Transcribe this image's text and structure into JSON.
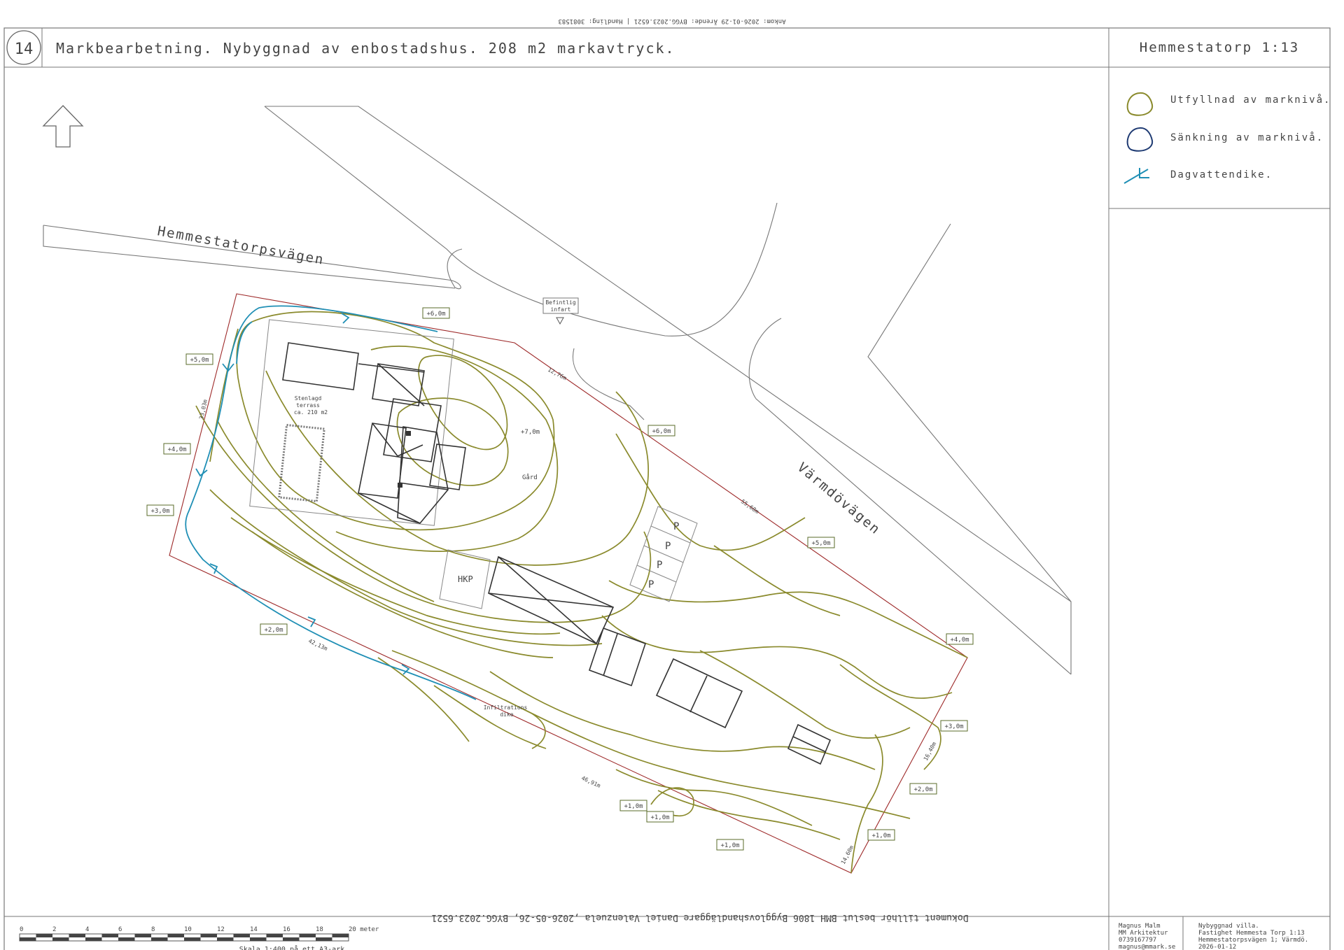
{
  "top_stamp": "Ankom: 2026-01-29 Ärende: BYGG.2023.6521 | Handling: 3081583",
  "sheet_number": "14",
  "header_title": "Markbearbetning. Nybyggnad av enbostadshus. 208 m2 markavtryck.",
  "header_right": "Hemmestatorp 1:13",
  "legend": {
    "fill": "Utfyllnad av marknivå.",
    "lower": "Sänkning av marknivå.",
    "ditch": "Dagvattendike."
  },
  "colors": {
    "fill_contour": "#8a8a2c",
    "lower_contour": "#1f3b73",
    "ditch": "#1f8fb5",
    "boundary": "#9e2a2a",
    "line": "#555555"
  },
  "roads": {
    "road1": "Hemmestatorpsvägen",
    "road2": "Värmdövägen"
  },
  "site_labels": {
    "entrance": [
      "Befintlig",
      "infart"
    ],
    "terrace": [
      "Stenlagd",
      "terrass",
      "ca. 210 m2"
    ],
    "yard": "Gård",
    "peak": "+7,0m",
    "hkp": "HKP",
    "infiltration": [
      "Infiltrations",
      "dike"
    ],
    "parking": [
      "P",
      "P",
      "P",
      "P"
    ]
  },
  "boundary_lengths": [
    "12,76m",
    "55,68m",
    "16,40m",
    "14,60m",
    "46,91m",
    "42,13m",
    "33,03m"
  ],
  "levels": [
    "+6,0m",
    "+5,0m",
    "+4,0m",
    "+3,0m",
    "+2,0m",
    "+6,0m",
    "+5,0m",
    "+4,0m",
    "+3,0m",
    "+2,0m",
    "+1,0m",
    "+1,0m",
    "+1,0m",
    "+1,0m"
  ],
  "scale": {
    "ticks": [
      "0",
      "2",
      "4",
      "6",
      "8",
      "10",
      "12",
      "14",
      "16",
      "18",
      "20 meter"
    ],
    "caption": "Skala 1:400 på ett A3-ark."
  },
  "footer_center": "Dokument tillhör beslut BMH 1806 Bygglovshandläggare Daniel Valenzuela ,2026-05-26, BYGG.2023.6521",
  "author": [
    "Magnus Malm",
    "MM Arkitektur",
    "0739167797",
    "magnus@mmark.se"
  ],
  "project": [
    "Nybyggnad villa.",
    "Fastighet Hemmesta Torp 1:13",
    "Hemmestatorpsvägen 1; Värmdö.",
    "2026-01-12"
  ]
}
